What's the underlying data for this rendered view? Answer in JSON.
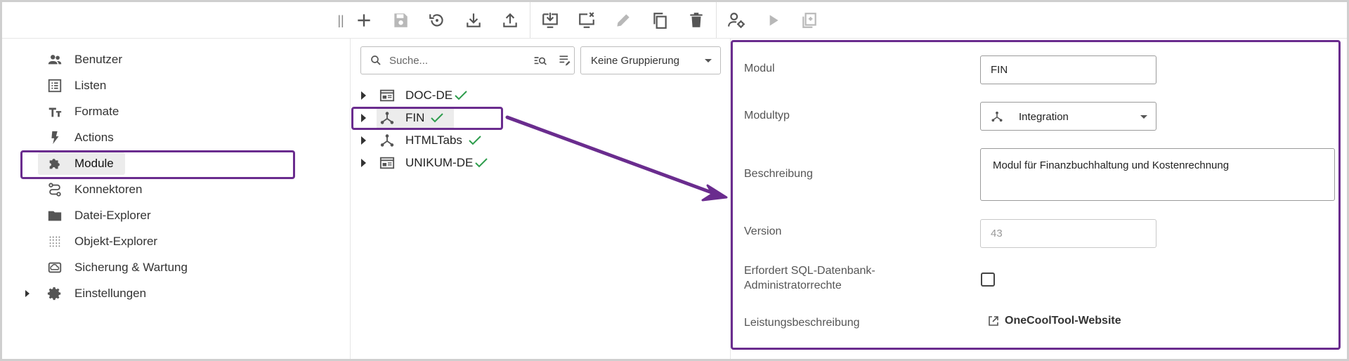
{
  "colors": {
    "highlight": "#6a2c8e",
    "check": "#2e9d4d",
    "icon": "#555555",
    "icon_disabled": "#b8b8b8",
    "selected_bg": "#ececec"
  },
  "toolbar": {
    "grip": "||",
    "buttons": [
      {
        "icon": "plus-icon",
        "enabled": true
      },
      {
        "icon": "save-icon",
        "enabled": false
      },
      {
        "icon": "restore-icon",
        "enabled": true
      },
      {
        "icon": "download-icon",
        "enabled": true
      },
      {
        "icon": "upload-icon",
        "enabled": true
      },
      {
        "icon": "deploy-icon",
        "enabled": true
      },
      {
        "icon": "undeploy-icon",
        "enabled": true
      },
      {
        "icon": "edit-icon",
        "enabled": false
      },
      {
        "icon": "copy-icon",
        "enabled": true
      },
      {
        "icon": "delete-icon",
        "enabled": true
      },
      {
        "icon": "user-settings-icon",
        "enabled": true
      },
      {
        "icon": "run-icon",
        "enabled": false
      },
      {
        "icon": "paste-icon",
        "enabled": false
      }
    ]
  },
  "sidebar": {
    "items": [
      {
        "label": "Benutzer",
        "icon": "users-icon"
      },
      {
        "label": "Listen",
        "icon": "list-icon"
      },
      {
        "label": "Formate",
        "icon": "text-format-icon"
      },
      {
        "label": "Actions",
        "icon": "bolt-icon"
      },
      {
        "label": "Module",
        "icon": "puzzle-icon",
        "active": true
      },
      {
        "label": "Konnektoren",
        "icon": "route-icon"
      },
      {
        "label": "Datei-Explorer",
        "icon": "folder-icon"
      },
      {
        "label": "Objekt-Explorer",
        "icon": "grid-dots-icon"
      },
      {
        "label": "Sicherung & Wartung",
        "icon": "backup-icon"
      },
      {
        "label": "Einstellungen",
        "icon": "gear-icon",
        "expandable": true
      }
    ]
  },
  "search": {
    "placeholder": "Suche...",
    "grouping": "Keine Gruppierung"
  },
  "tree": {
    "items": [
      {
        "label": "DOC-DE",
        "icon": "window-icon",
        "status": "ok"
      },
      {
        "label": "FIN",
        "icon": "integration-icon",
        "status": "ok",
        "selected": true
      },
      {
        "label": "HTMLTabs",
        "icon": "integration-icon",
        "status": "ok"
      },
      {
        "label": "UNIKUM-DE",
        "icon": "window-icon",
        "status": "ok"
      }
    ]
  },
  "detail": {
    "modul_label": "Modul",
    "modul_value": "FIN",
    "modultyp_label": "Modultyp",
    "modultyp_value": "Integration",
    "beschreibung_label": "Beschreibung",
    "beschreibung_value": "Modul für Finanzbuchhaltung und Kostenrechnung",
    "version_label": "Version",
    "version_value": "43",
    "sql_label_line1": "Erfordert SQL-Datenbank-",
    "sql_label_line2": "Administratorrechte",
    "sql_checked": false,
    "leistung_label": "Leistungsbeschreibung",
    "leistung_link": "OneCoolTool-Website"
  }
}
